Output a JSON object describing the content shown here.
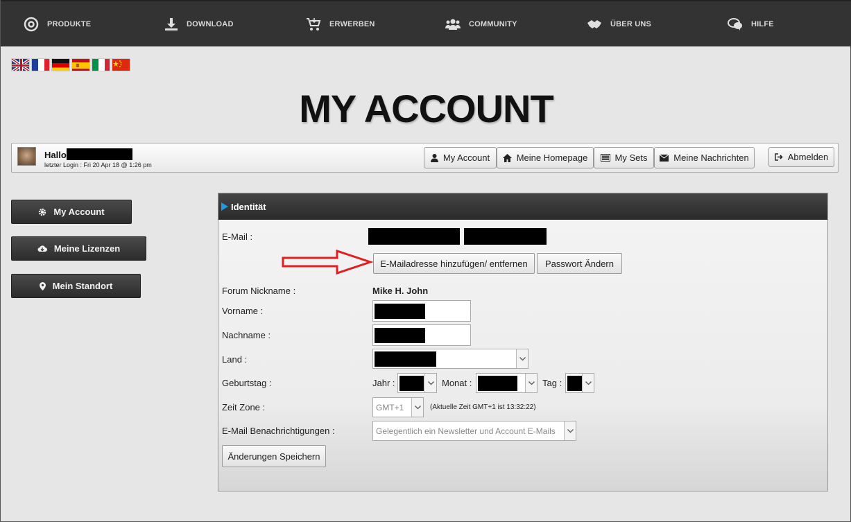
{
  "nav": [
    {
      "label": "PRODUKTE",
      "icon": "target-icon"
    },
    {
      "label": "DOWNLOAD",
      "icon": "download-icon"
    },
    {
      "label": "ERWERBEN",
      "icon": "cart-icon"
    },
    {
      "label": "COMMUNITY",
      "icon": "users-icon"
    },
    {
      "label": "ÜBER UNS",
      "icon": "handshake-icon"
    },
    {
      "label": "HILFE",
      "icon": "chat-bubbles-icon"
    }
  ],
  "flags": [
    "flag-uk-icon",
    "flag-france-icon",
    "flag-germany-icon",
    "flag-spain-icon",
    "flag-italy-icon",
    "flag-china-icon"
  ],
  "page": {
    "title": "MY ACCOUNT"
  },
  "user": {
    "greeting": "Hallo",
    "last_login": "letzter Login : Fri 20 Apr 18 @ 1:26 pm"
  },
  "userbar": {
    "my_account": "My Account",
    "homepage": "Meine Homepage",
    "sets": "My Sets",
    "messages": "Meine Nachrichten",
    "logout": "Abmelden"
  },
  "sidebar": {
    "my_account": "My Account",
    "licenses": "Meine Lizenzen",
    "location": "Mein Standort"
  },
  "panel": {
    "title": "Identität",
    "email_label": "E-Mail :",
    "email_button": "E-Mailadresse hinzufügen/ entfernen",
    "password_button": "Passwort Ändern",
    "nickname_label": "Forum Nickname :",
    "nickname_value": "Mike H. John",
    "firstname_label": "Vorname :",
    "lastname_label": "Nachname :",
    "country_label": "Land :",
    "birthday_label": "Geburtstag :",
    "year_label": "Jahr :",
    "month_label": "Monat :",
    "day_label": "Tag :",
    "timezone_label": "Zeit Zone :",
    "timezone_value": "GMT+1",
    "current_time": "(Aktuelle Zeit GMT+1 ist 13:32:22)",
    "notify_label": "E-Mail Benachrichtigungen :",
    "notify_value": "Gelegentlich ein Newsletter und Account E-Mails",
    "save_button": "Änderungen Speichern"
  },
  "colors": {
    "nav_bg": "#333333",
    "accent_arrow": "#e02020",
    "panel_triangle": "#1c9be0"
  }
}
